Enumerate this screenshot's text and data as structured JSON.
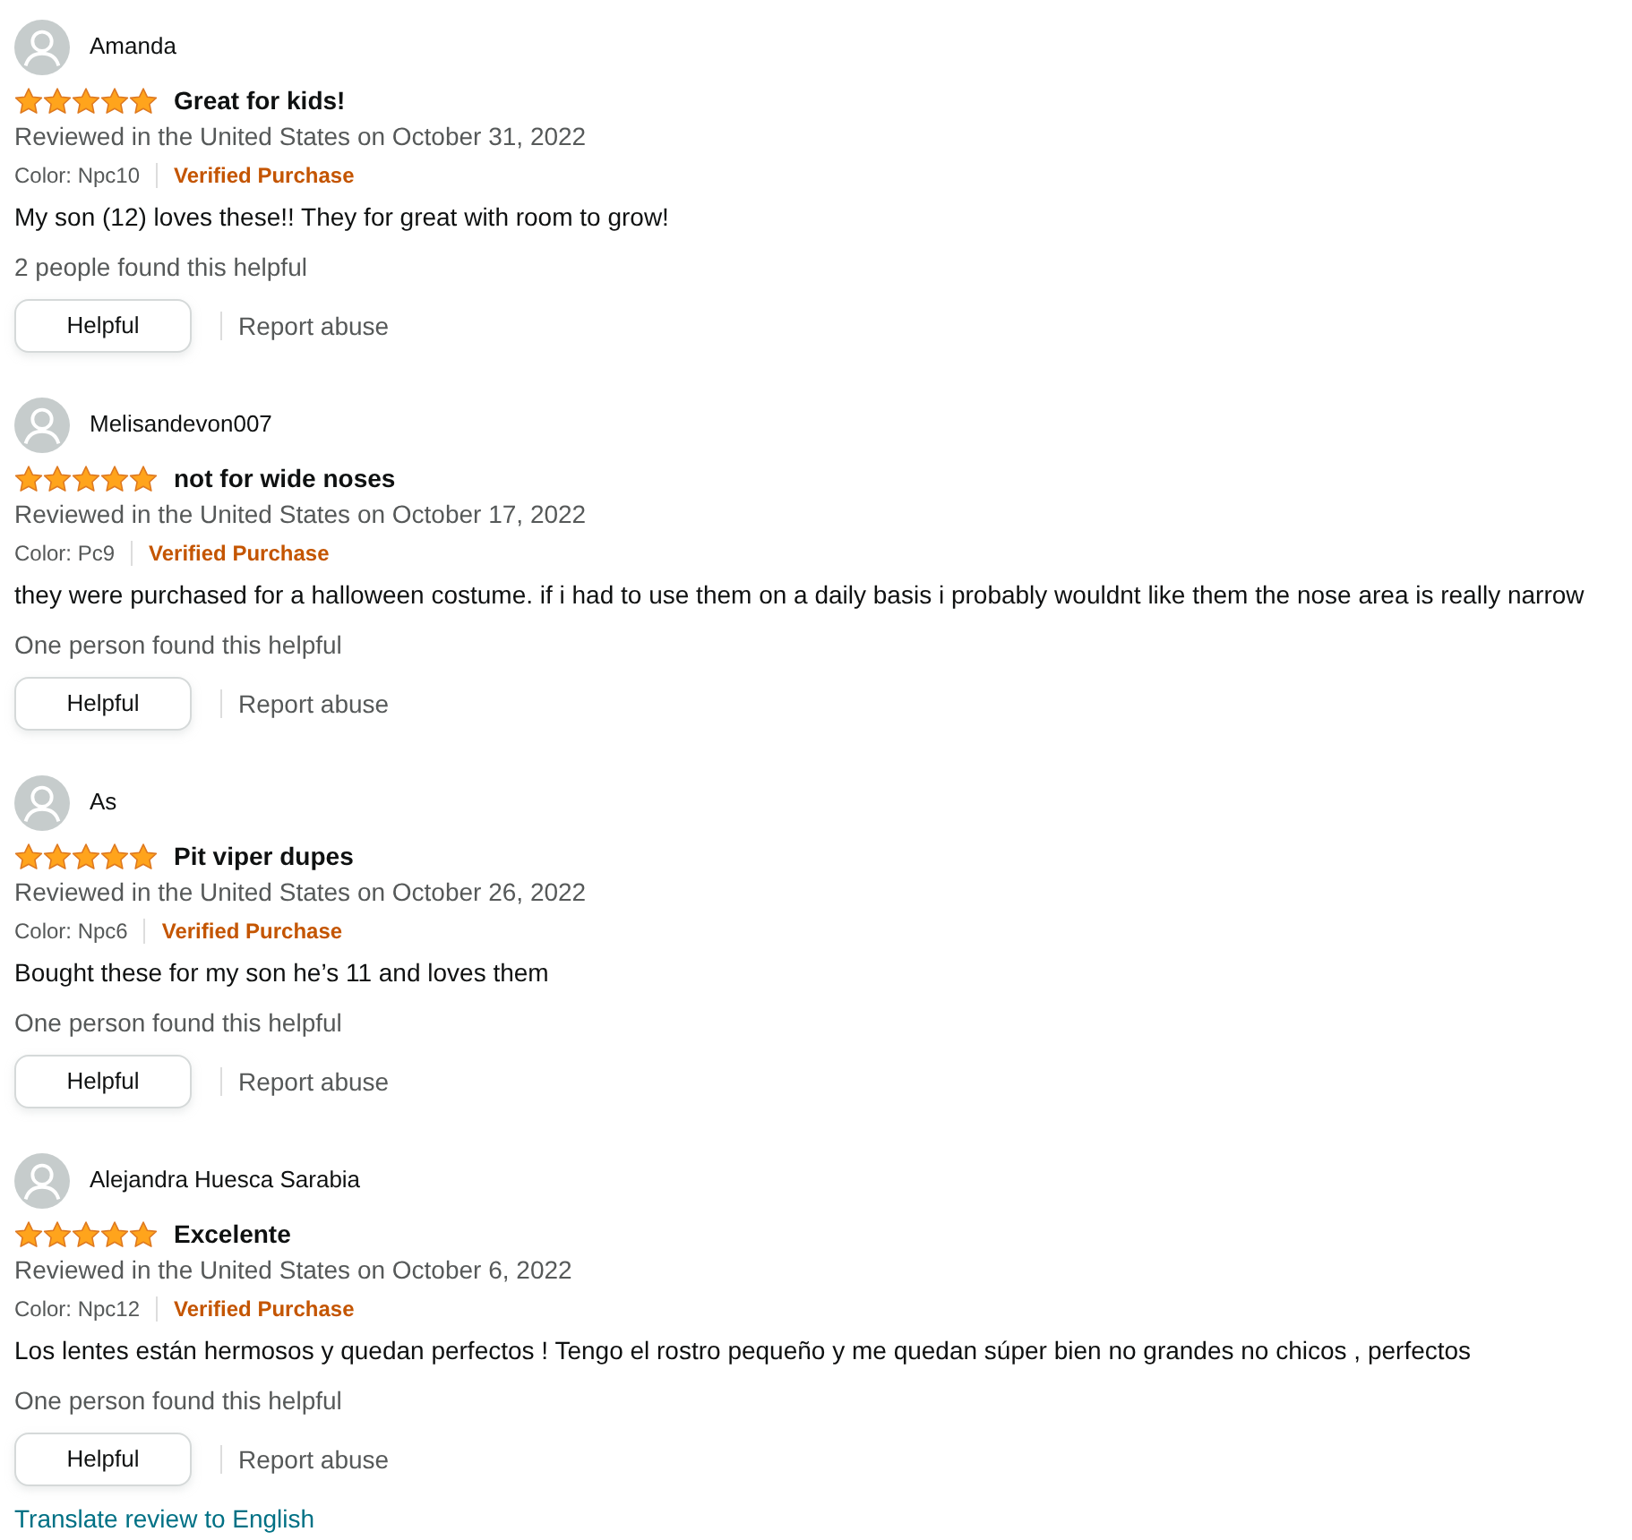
{
  "reviews": [
    {
      "reviewer": "Amanda",
      "stars": 5,
      "title": "Great for kids!",
      "date_line": "Reviewed in the United States on October 31, 2022",
      "variant": "Color: Npc10",
      "verified": "Verified Purchase",
      "body": "My son (12) loves these!! They for great with room to grow!",
      "helpful_count": "2 people found this helpful",
      "helpful_button": "Helpful",
      "report_link": "Report abuse"
    },
    {
      "reviewer": "Melisandevon007",
      "stars": 5,
      "title": "not for wide noses",
      "date_line": "Reviewed in the United States on October 17, 2022",
      "variant": "Color: Pc9",
      "verified": "Verified Purchase",
      "body": "they were purchased for a halloween costume. if i had to use them on a daily basis i probably wouldnt like them the nose area is really narrow",
      "helpful_count": "One person found this helpful",
      "helpful_button": "Helpful",
      "report_link": "Report abuse"
    },
    {
      "reviewer": "As",
      "stars": 5,
      "title": "Pit viper dupes",
      "date_line": "Reviewed in the United States on October 26, 2022",
      "variant": "Color: Npc6",
      "verified": "Verified Purchase",
      "body": "Bought these for my son he’s 11 and loves them",
      "helpful_count": "One person found this helpful",
      "helpful_button": "Helpful",
      "report_link": "Report abuse"
    },
    {
      "reviewer": "Alejandra Huesca Sarabia",
      "stars": 5,
      "title": "Excelente",
      "date_line": "Reviewed in the United States on October 6, 2022",
      "variant": "Color: Npc12",
      "verified": "Verified Purchase",
      "body": "Los lentes están hermosos y quedan perfectos ! Tengo el rostro pequeño y me quedan súper bien no grandes no chicos , perfectos",
      "helpful_count": "One person found this helpful",
      "helpful_button": "Helpful",
      "report_link": "Report abuse",
      "translate_link": "Translate review to English"
    }
  ]
}
